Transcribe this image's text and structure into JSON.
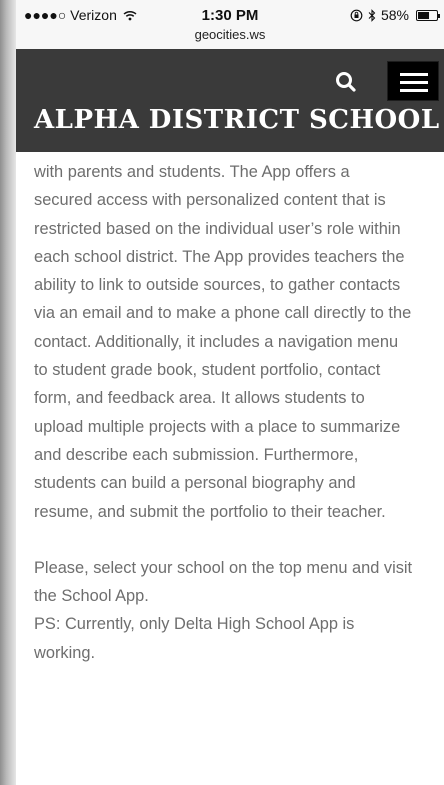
{
  "status_bar": {
    "signal": "●●●●○",
    "carrier": "Verizon",
    "time": "1:30 PM",
    "url": "geocities.ws",
    "battery_percent": "58%",
    "battery_level": 0.58
  },
  "header": {
    "site_title": "ALPHA DISTRICT SCHOOL",
    "search_icon": "search-icon",
    "menu_icon": "hamburger-menu-icon"
  },
  "content": {
    "paragraph_1_lines": [
      "with parents and students. The App offers a",
      "secured access with personalized content that is",
      "restricted based on the individual user’s role within",
      "each school district. The App provides teachers the",
      "ability to link to outside sources, to gather contacts",
      "via an email and to make a phone call directly to the",
      "contact. Additionally, it includes a navigation menu",
      "to student grade book, student portfolio, contact",
      "form, and feedback area. It allows students to",
      "upload multiple projects with a place to summarize",
      "and describe each submission. Furthermore,",
      "students can build a personal biography and",
      "resume, and submit the portfolio to their teacher."
    ],
    "paragraph_2_lines": [
      "Please, select your school on the top menu and visit",
      "the School App."
    ],
    "ps_lines": [
      "PS: Currently, only Delta High School App is",
      "working."
    ]
  },
  "colors": {
    "header_bg": "#3a3a3a",
    "menu_button_bg": "#000000",
    "title_text": "#ffffff",
    "body_text": "#6e6e6e"
  }
}
